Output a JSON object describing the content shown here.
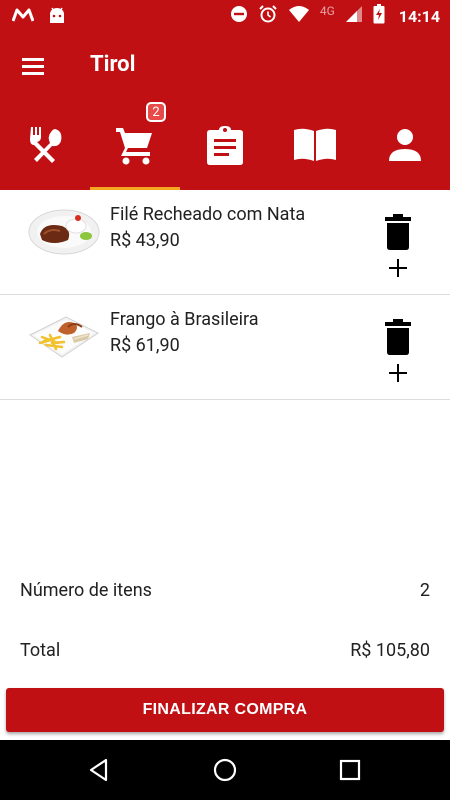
{
  "status_bar": {
    "time": "14:14",
    "network": "4G",
    "icons": [
      "m-app-icon",
      "android-icon",
      "do-not-disturb-icon",
      "alarm-icon",
      "wifi-icon",
      "signal-icon",
      "battery-icon"
    ]
  },
  "app_bar": {
    "title": "Tirol",
    "menu_icon": "menu-icon"
  },
  "tabs": [
    {
      "name": "menu",
      "icon": "utensils-icon",
      "active": false
    },
    {
      "name": "cart",
      "icon": "cart-icon",
      "active": true,
      "badge": "2"
    },
    {
      "name": "orders",
      "icon": "clipboard-icon",
      "active": false
    },
    {
      "name": "about",
      "icon": "book-icon",
      "active": false
    },
    {
      "name": "profile",
      "icon": "person-icon",
      "active": false
    }
  ],
  "cart_items": [
    {
      "name": "Filé Recheado com Nata",
      "price": "R$ 43,90",
      "image": "steak-dish"
    },
    {
      "name": "Frango à Brasileira",
      "price": "R$ 61,90",
      "image": "chicken-fries-dish"
    }
  ],
  "summary": {
    "count_label": "Número de itens",
    "count_value": "2",
    "total_label": "Total",
    "total_value": "R$ 105,80"
  },
  "checkout_label": "FINALIZAR COMPRA",
  "colors": {
    "primary": "#c01014",
    "tab_indicator": "#f5a623",
    "badge": "#e84a4a",
    "text": "#212121"
  }
}
